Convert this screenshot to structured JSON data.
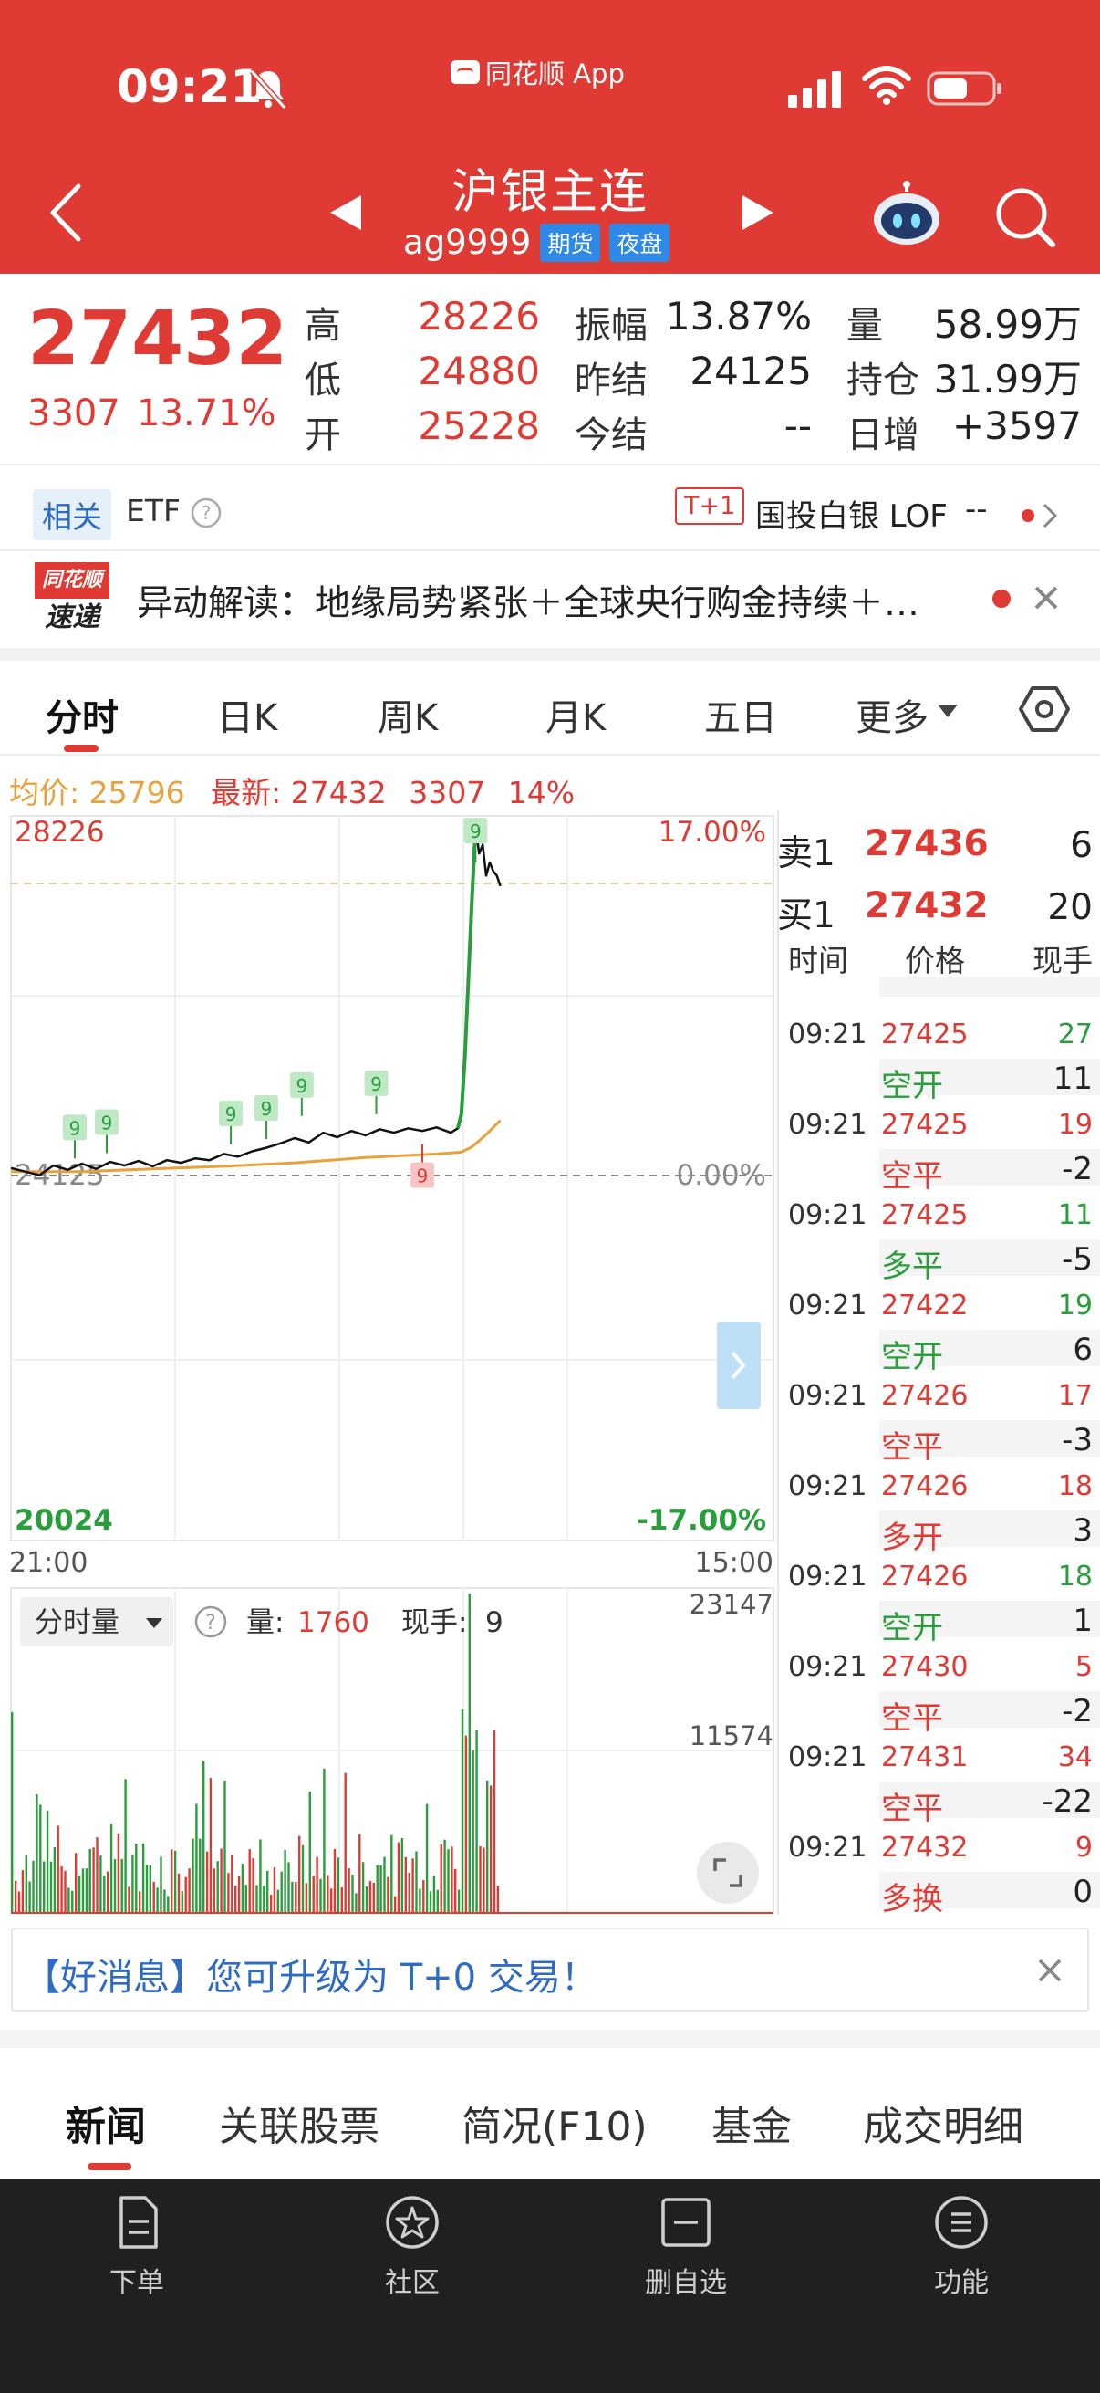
{
  "status_bar": {
    "time": "09:21",
    "app_tag": "同花顺 App"
  },
  "header": {
    "title": "沪银主连",
    "code": "ag9999",
    "badges": [
      "期货",
      "夜盘"
    ]
  },
  "quote": {
    "price": "27432",
    "change": "3307",
    "change_pct": "13.71%",
    "stats": [
      {
        "label": "高",
        "value": "28226"
      },
      {
        "label": "低",
        "value": "24880"
      },
      {
        "label": "开",
        "value": "25228"
      },
      {
        "label": "振幅",
        "value": "13.87%"
      },
      {
        "label": "昨结",
        "value": "24125"
      },
      {
        "label": "今结",
        "value": "--"
      },
      {
        "label": "量",
        "value": "58.99万"
      },
      {
        "label": "持仓",
        "value": "31.99万"
      },
      {
        "label": "日增",
        "value": "+3597"
      }
    ]
  },
  "etf": {
    "tag": "相关",
    "label": "ETF",
    "t1": "T+1",
    "lof_name": "国投白银 LOF",
    "lof_value": "--"
  },
  "alert": {
    "logo_top": "同花顺",
    "logo_bottom": "速递",
    "text": "异动解读：地缘局势紧张＋全球央行购金持续＋…"
  },
  "chart_tabs": [
    "分时",
    "日K",
    "周K",
    "月K",
    "五日",
    "更多"
  ],
  "stats_line": {
    "avg_label": "均价:",
    "avg_value": "25796",
    "latest_label": "最新:",
    "latest_value": "27432",
    "latest_change": "3307",
    "latest_pct": "14%"
  },
  "chart_data": {
    "type": "line",
    "title": "",
    "y_top": "28226",
    "y_bottom": "20024",
    "y_mid": "24125",
    "pct_top": "17.00%",
    "pct_mid": "0.00%",
    "pct_bottom": "-17.00%",
    "x_start": "21:00",
    "x_end": "15:00",
    "ylim": [
      20024,
      28226
    ],
    "price_series": [
      [
        0,
        24240
      ],
      [
        4,
        24200
      ],
      [
        8,
        24160
      ],
      [
        12,
        24270
      ],
      [
        16,
        24220
      ],
      [
        20,
        24290
      ],
      [
        24,
        24230
      ],
      [
        28,
        24310
      ],
      [
        32,
        24270
      ],
      [
        36,
        24320
      ],
      [
        40,
        24260
      ],
      [
        44,
        24330
      ],
      [
        48,
        24300
      ],
      [
        52,
        24350
      ],
      [
        56,
        24330
      ],
      [
        60,
        24400
      ],
      [
        64,
        24370
      ],
      [
        68,
        24430
      ],
      [
        72,
        24470
      ],
      [
        76,
        24520
      ],
      [
        80,
        24580
      ],
      [
        84,
        24530
      ],
      [
        88,
        24640
      ],
      [
        92,
        24590
      ],
      [
        96,
        24660
      ],
      [
        100,
        24610
      ],
      [
        104,
        24680
      ],
      [
        108,
        24640
      ],
      [
        112,
        24690
      ],
      [
        116,
        24660
      ],
      [
        120,
        24700
      ],
      [
        124,
        24640
      ],
      [
        126,
        24690
      ],
      [
        127,
        24850
      ],
      [
        128,
        25500
      ],
      [
        129,
        26400
      ],
      [
        130,
        27300
      ],
      [
        131,
        28100
      ],
      [
        132,
        27800
      ],
      [
        133,
        27900
      ],
      [
        134,
        27550
      ],
      [
        135,
        27700
      ],
      [
        136,
        27600
      ],
      [
        137,
        27550
      ],
      [
        138,
        27432
      ]
    ],
    "avg_series": [
      [
        0,
        24200
      ],
      [
        20,
        24200
      ],
      [
        40,
        24230
      ],
      [
        60,
        24260
      ],
      [
        80,
        24300
      ],
      [
        100,
        24360
      ],
      [
        120,
        24400
      ],
      [
        127,
        24420
      ],
      [
        130,
        24480
      ],
      [
        134,
        24620
      ],
      [
        138,
        24780
      ]
    ],
    "x_count": 138,
    "x_total": 215,
    "volume": {
      "label": "分时量",
      "volume_label": "量:",
      "volume_value": "1760",
      "hand_label": "现手:",
      "hand_value": "9",
      "ymax": "23147",
      "ymid": "11574"
    },
    "markers": [
      {
        "x": 18,
        "y": 24700,
        "label": "9",
        "type": "buy"
      },
      {
        "x": 27,
        "y": 24760,
        "label": "9",
        "type": "buy"
      },
      {
        "x": 62,
        "y": 24860,
        "label": "9",
        "type": "buy"
      },
      {
        "x": 72,
        "y": 24920,
        "label": "9",
        "type": "buy"
      },
      {
        "x": 82,
        "y": 25180,
        "label": "9",
        "type": "buy"
      },
      {
        "x": 103,
        "y": 25200,
        "label": "9",
        "type": "buy"
      },
      {
        "x": 116,
        "y": 24160,
        "label": "9",
        "type": "sell"
      },
      {
        "x": 131,
        "y": 28060,
        "label": "9",
        "type": "buy"
      }
    ]
  },
  "order_book": {
    "sell_label": "卖1",
    "sell_price": "27436",
    "sell_vol": "6",
    "buy_label": "买1",
    "buy_price": "27432",
    "buy_vol": "20"
  },
  "trades_header": [
    "时间",
    "价格",
    "现手"
  ],
  "trades": [
    {
      "time": "09:21",
      "price": "27425",
      "vol": "27",
      "vol_color": "#2a9d3c",
      "type": "空开",
      "type_color": "#2a9d3c",
      "net": "11"
    },
    {
      "time": "09:21",
      "price": "27425",
      "vol": "19",
      "vol_color": "#e03a34",
      "type": "空平",
      "type_color": "#e03a34",
      "net": "-2"
    },
    {
      "time": "09:21",
      "price": "27425",
      "vol": "11",
      "vol_color": "#2a9d3c",
      "type": "多平",
      "type_color": "#2a9d3c",
      "net": "-5"
    },
    {
      "time": "09:21",
      "price": "27422",
      "vol": "19",
      "vol_color": "#2a9d3c",
      "type": "空开",
      "type_color": "#2a9d3c",
      "net": "6"
    },
    {
      "time": "09:21",
      "price": "27426",
      "vol": "17",
      "vol_color": "#e03a34",
      "type": "空平",
      "type_color": "#e03a34",
      "net": "-3"
    },
    {
      "time": "09:21",
      "price": "27426",
      "vol": "18",
      "vol_color": "#e03a34",
      "type": "多开",
      "type_color": "#e03a34",
      "net": "3"
    },
    {
      "time": "09:21",
      "price": "27426",
      "vol": "18",
      "vol_color": "#2a9d3c",
      "type": "空开",
      "type_color": "#2a9d3c",
      "net": "1"
    },
    {
      "time": "09:21",
      "price": "27430",
      "vol": "5",
      "vol_color": "#e03a34",
      "type": "空平",
      "type_color": "#e03a34",
      "net": "-2"
    },
    {
      "time": "09:21",
      "price": "27431",
      "vol": "34",
      "vol_color": "#e03a34",
      "type": "空平",
      "type_color": "#e03a34",
      "net": "-22"
    },
    {
      "time": "09:21",
      "price": "27432",
      "vol": "9",
      "vol_color": "#e03a34",
      "type": "多换",
      "type_color": "#e03a34",
      "net": "0"
    }
  ],
  "promo": {
    "text": "【好消息】您可升级为 T+0 交易！"
  },
  "bottom_tabs": [
    "新闻",
    "关联股票",
    "简况(F10)",
    "基金",
    "成交明细"
  ],
  "toolbar": [
    "下单",
    "社区",
    "删自选",
    "功能"
  ],
  "colors": {
    "brand": "#e03a34",
    "up": "#e03a34",
    "down": "#2a9d3c",
    "avg_line": "#e8a13c",
    "link": "#2e6bc4"
  }
}
